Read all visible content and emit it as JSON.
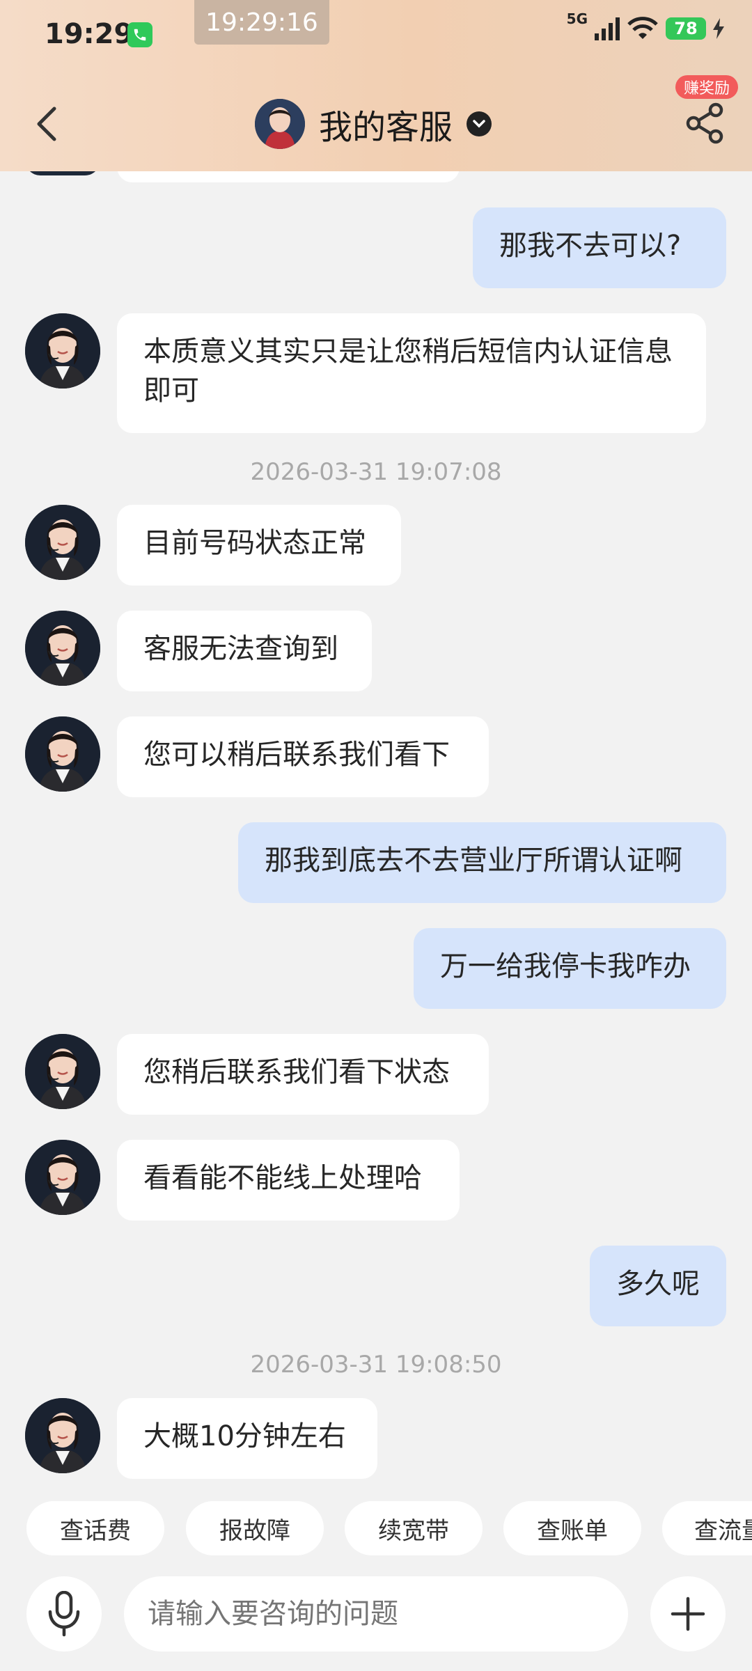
{
  "status_bar": {
    "time": "19:29",
    "recording_time": "19:29:16",
    "network": "5G",
    "battery": "78"
  },
  "header": {
    "title": "我的客服",
    "reward_badge": "赚奖励"
  },
  "messages": [
    {
      "sender": "user",
      "text": "那我不去可以?"
    },
    {
      "sender": "agent",
      "text": "本质意义其实只是让您稍后短信内认证信息即可"
    },
    {
      "type": "timestamp",
      "text": "2026-03-31 19:07:08"
    },
    {
      "sender": "agent",
      "text": "目前号码状态正常"
    },
    {
      "sender": "agent",
      "text": "客服无法查询到"
    },
    {
      "sender": "agent",
      "text": "您可以稍后联系我们看下"
    },
    {
      "sender": "user",
      "text": "那我到底去不去营业厅所谓认证啊"
    },
    {
      "sender": "user",
      "text": "万一给我停卡我咋办"
    },
    {
      "sender": "agent",
      "text": "您稍后联系我们看下状态"
    },
    {
      "sender": "agent",
      "text": "看看能不能线上处理哈"
    },
    {
      "sender": "user",
      "text": "多久呢"
    },
    {
      "type": "timestamp",
      "text": "2026-03-31 19:08:50"
    },
    {
      "sender": "agent",
      "text": "大概10分钟左右"
    }
  ],
  "quick_replies": [
    "查话费",
    "报故障",
    "续宽带",
    "查账单",
    "查流量"
  ],
  "input": {
    "placeholder": "请输入要咨询的问题"
  }
}
